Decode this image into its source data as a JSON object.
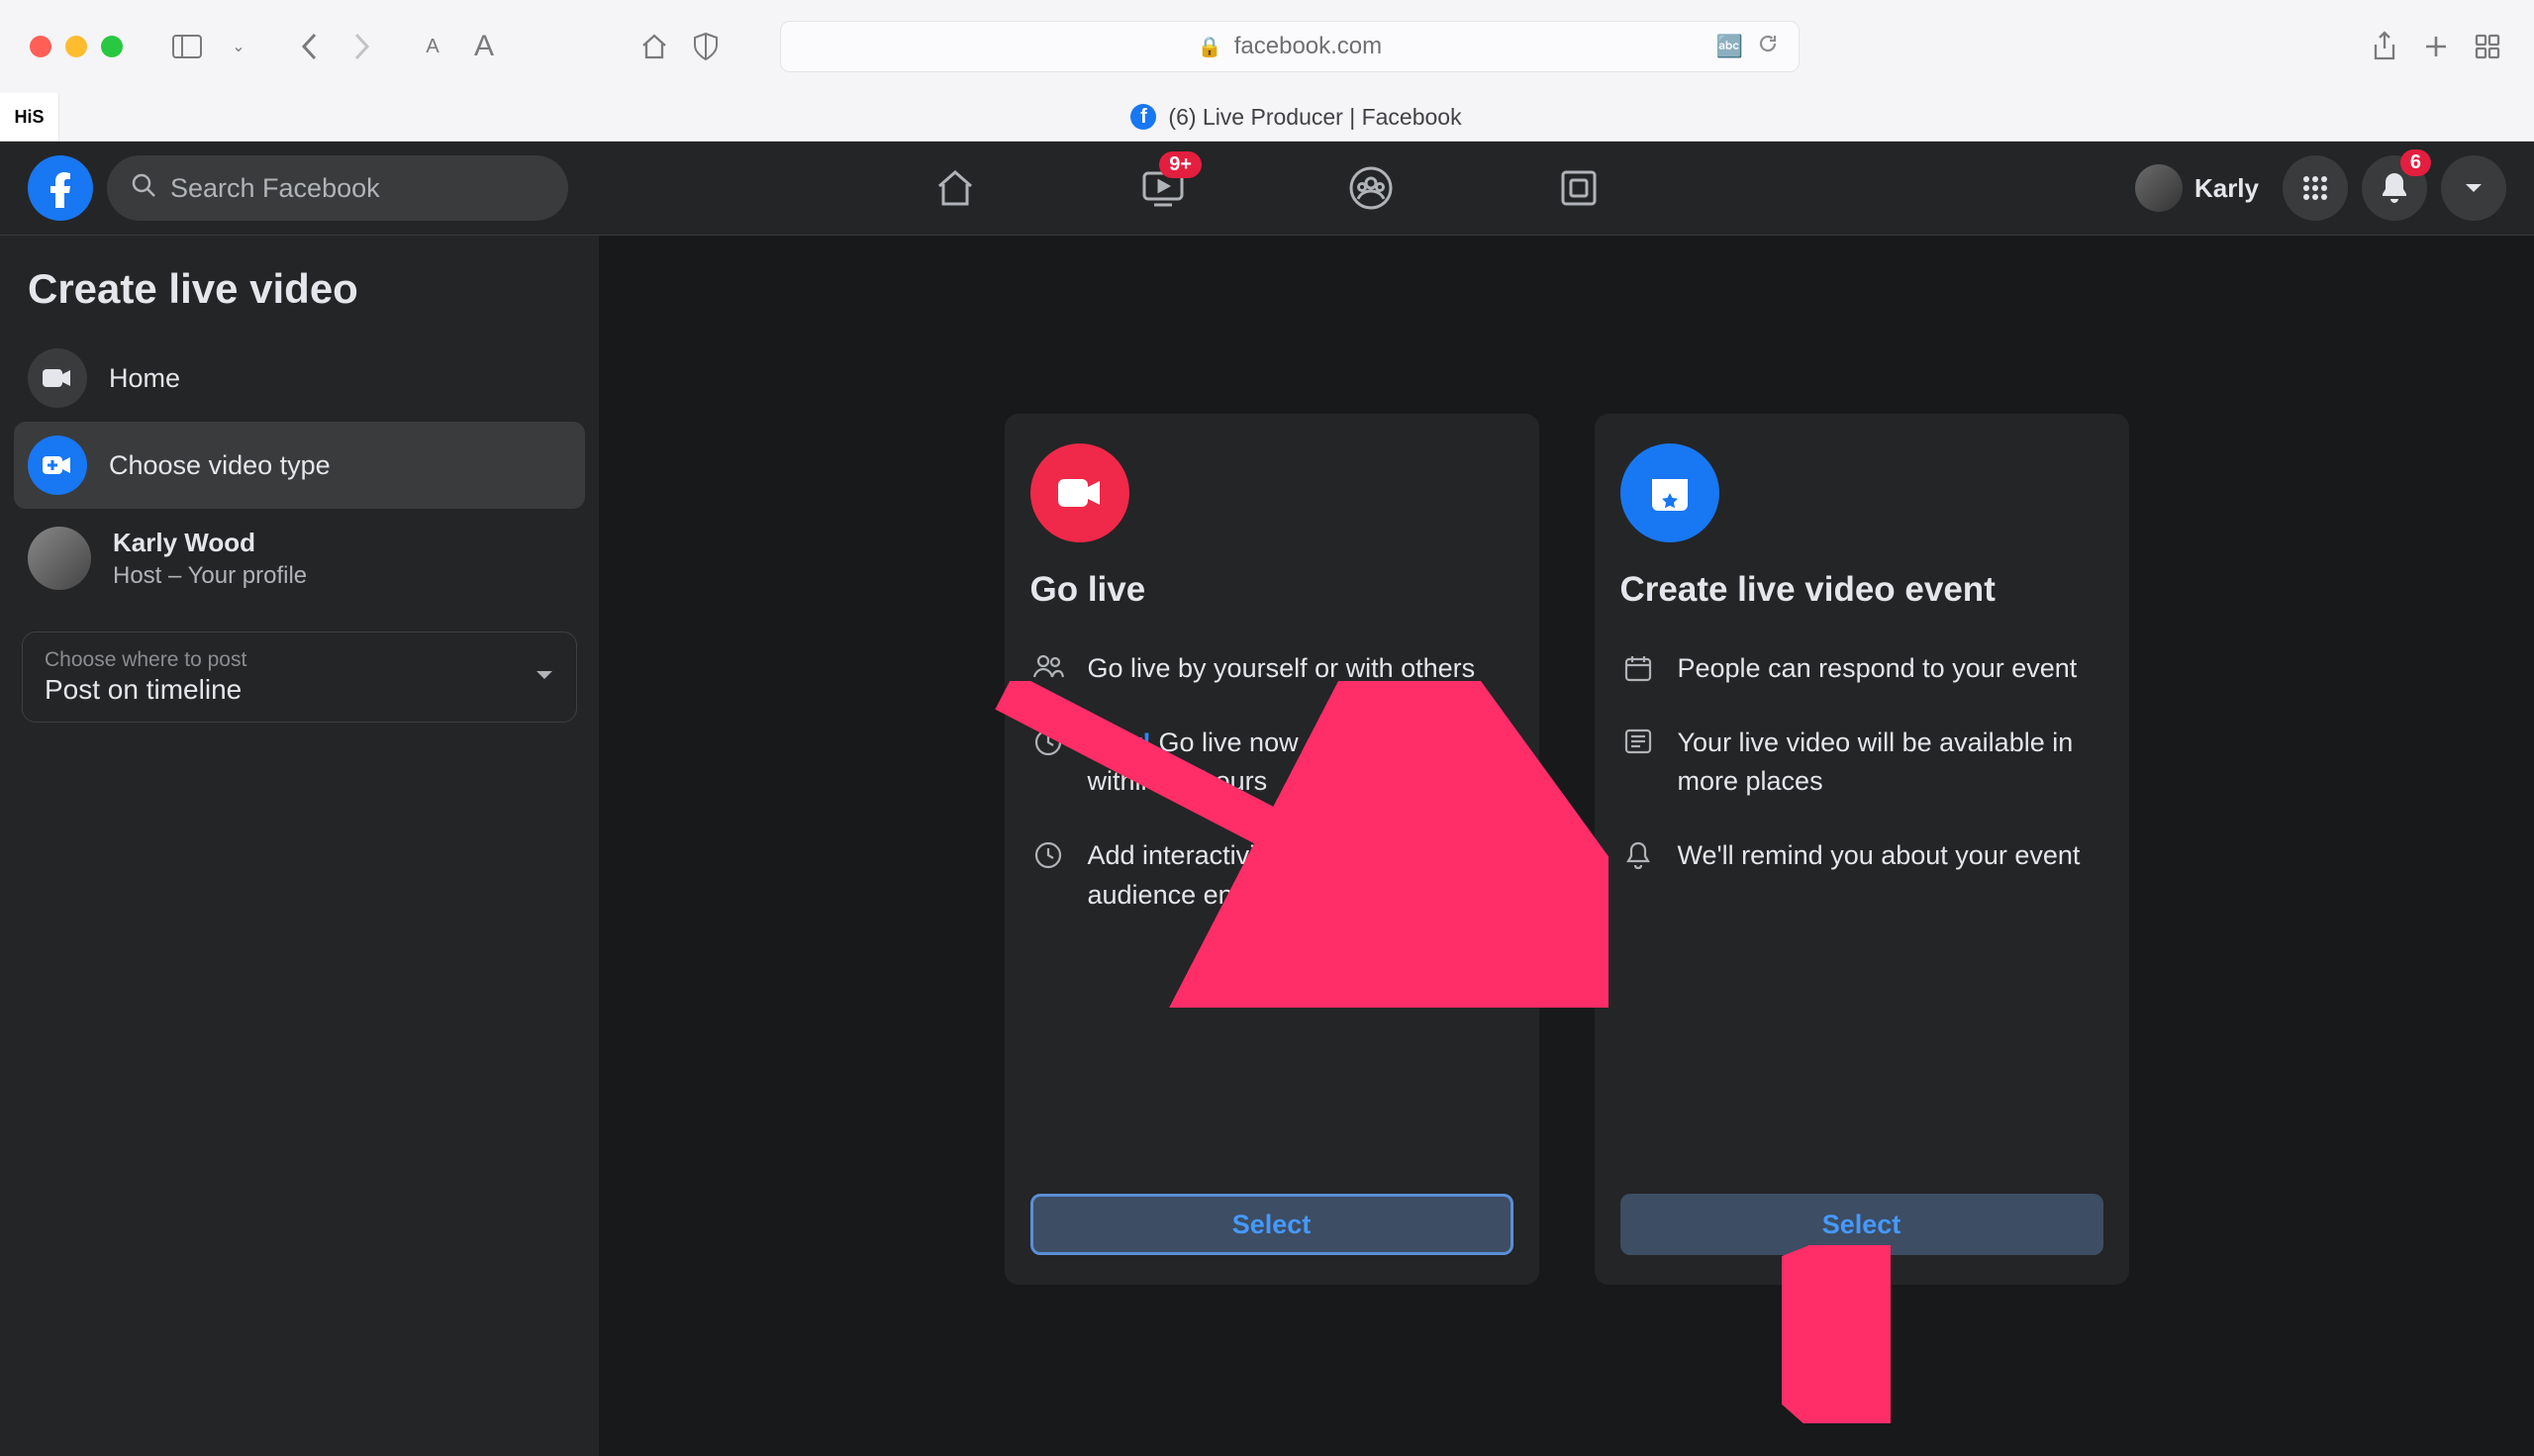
{
  "browser": {
    "url_display": "facebook.com",
    "tab_label_small": "HiS",
    "tab_label_main": "(6) Live Producer | Facebook"
  },
  "fb_header": {
    "search_placeholder": "Search Facebook",
    "watch_badge": "9+",
    "notif_badge": "6",
    "profile_name": "Karly"
  },
  "sidebar": {
    "title": "Create live video",
    "items": [
      {
        "label": "Home"
      },
      {
        "label": "Choose video type"
      }
    ],
    "profile": {
      "name": "Karly Wood",
      "subtitle": "Host – Your profile"
    },
    "select_label": "Choose where to post",
    "select_value": "Post on timeline"
  },
  "cards": {
    "go_live": {
      "title": "Go live",
      "feat1": "Go live by yourself or with others",
      "feat2_new": "New!",
      "feat2": " Go live now or automatically within 24 hours",
      "feat3": "Add interactivity tools to keep your audience engaged",
      "button": "Select"
    },
    "event": {
      "title": "Create live video event",
      "feat1": "People can respond to your event",
      "feat2": "Your live video will be available in more places",
      "feat3": "We'll remind you about your event",
      "button": "Select"
    }
  }
}
